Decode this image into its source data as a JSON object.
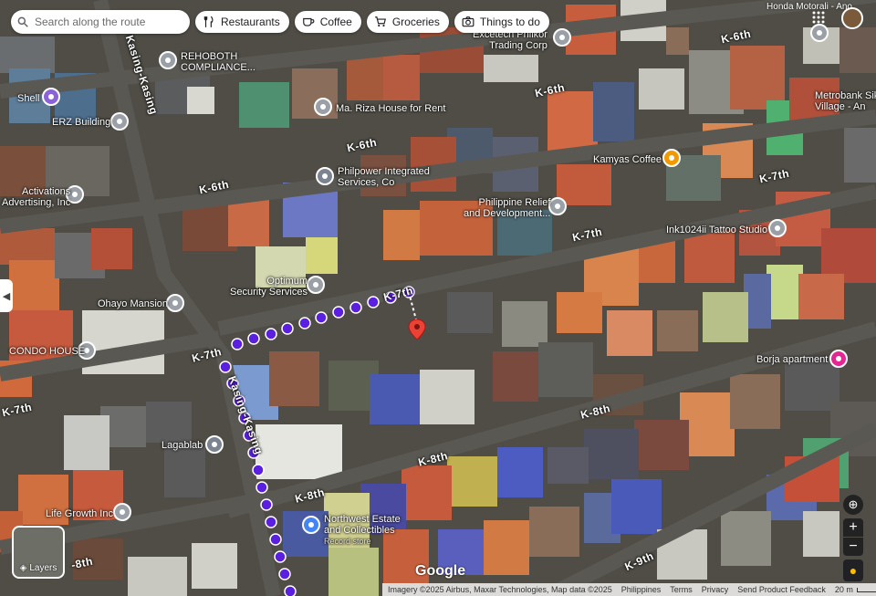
{
  "search": {
    "placeholder": "Search along the route"
  },
  "chips": [
    {
      "label": "Restaurants",
      "icon": "fork-knife-icon"
    },
    {
      "label": "Coffee",
      "icon": "coffee-cup-icon"
    },
    {
      "label": "Groceries",
      "icon": "cart-icon"
    },
    {
      "label": "Things to do",
      "icon": "camera-icon"
    }
  ],
  "places": {
    "rehoboth": "REHOBOTH\nCOMPLIANCE...",
    "shell": "Shell",
    "erz": "ERZ Building",
    "maRiza": "Ma. Riza House for Rent",
    "philpower": "Philpower Integrated\nServices, Co",
    "activations": "Activations\nAdvertising, Inc",
    "excetech": "Excetech Philkor\nTrading Corp",
    "kamyas": "Kamyas Coffee",
    "philrelief": "Philippine Relief\nand Development...",
    "ink": "Ink1024ii Tattoo Studio",
    "optimum": "Optimum\nSecurity Services",
    "ohayo": "Ohayo Mansion",
    "condo": "CONDO HOUSE",
    "borja": "Borja apartment",
    "lagablab": "Lagablab",
    "lifegrowth": "Life Growth Inc",
    "northwest": "Northwest Estate\nand Collectibles",
    "northwestSub": "Record store",
    "metrobank": "Metrobank Sik\nVillage - An",
    "honda": "Honda Motorali - Ano"
  },
  "roads": {
    "k6a": "K-6th",
    "k6b": "K-6th",
    "k6c": "K-6th",
    "k6d": "K-6th",
    "k7a": "K-7th",
    "k7b": "K-7th",
    "k7c": "K-7th",
    "k7d": "K-7th",
    "k7e": "K-7th",
    "k8a": "K-8th",
    "k8b": "K-8th",
    "k8c": "K-8th",
    "k8d": "-8th",
    "k9": "K-9th",
    "kasing1": "Kasing-Kasing",
    "kasing2": "Kasing-Kasing"
  },
  "layers_label": "Layers",
  "google": "Google",
  "footer": {
    "imagery": "Imagery ©2025 Airbus, Maxar Technologies, Map data ©2025",
    "country": "Philippines",
    "terms": "Terms",
    "privacy": "Privacy",
    "feedback": "Send Product Feedback",
    "scale": "20 m"
  },
  "colors": {
    "route": "#5b1fe0",
    "pin": "#ea4335"
  }
}
